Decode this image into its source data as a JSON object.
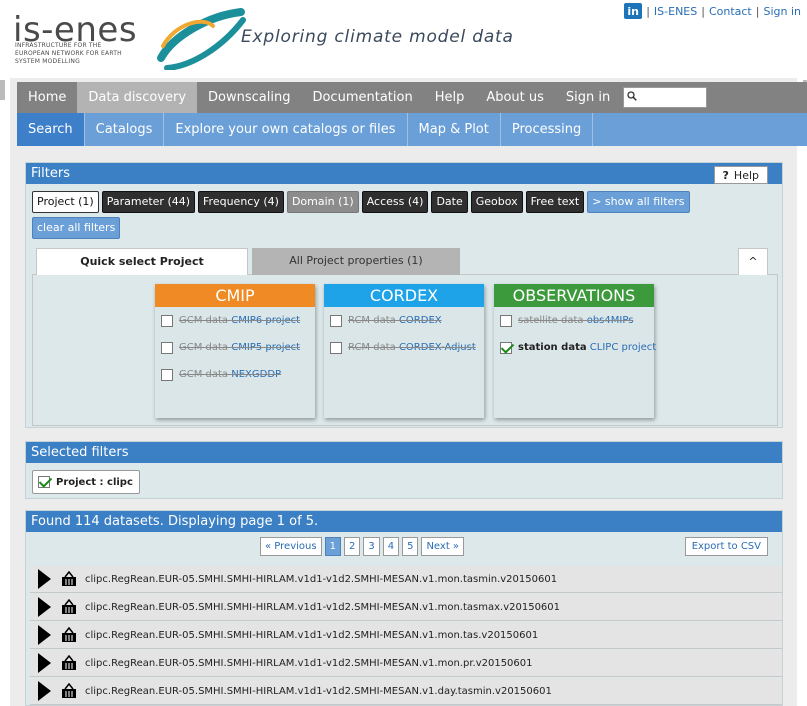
{
  "header": {
    "logo_text": "is-enes",
    "logo_subtitle": "INFRASTRUCTURE FOR THE EUROPEAN NETWORK FOR EARTH SYSTEM MODELLING",
    "tagline": "Exploring climate model data",
    "links": [
      "IS-ENES",
      "Contact",
      "Sign in"
    ],
    "linkedin": "in"
  },
  "nav_main": {
    "items": [
      "Home",
      "Data discovery",
      "Downscaling",
      "Documentation",
      "Help",
      "About us",
      "Sign in"
    ],
    "active": "Data discovery"
  },
  "nav_sub": {
    "items": [
      "Search",
      "Catalogs",
      "Explore your own catalogs or files",
      "Map & Plot",
      "Processing"
    ],
    "active": "Search"
  },
  "filters": {
    "title": "Filters",
    "help_label": "Help",
    "buttons": [
      "Project (1)",
      "Parameter (44)",
      "Frequency (4)",
      "Domain (1)",
      "Access (4)",
      "Date",
      "Geobox",
      "Free text",
      "> show all filters"
    ],
    "clear_label": "clear all filters",
    "tabs": [
      "Quick select Project",
      "All Project properties (1)",
      "^"
    ],
    "categories": [
      {
        "title": "CMIP",
        "color": "#f08a24",
        "rows": [
          {
            "text": "GCM data",
            "link": "CMIP6 project",
            "checked": false,
            "disabled": true
          },
          {
            "text": "GCM data",
            "link": "CMIP5 project",
            "checked": false,
            "disabled": true
          },
          {
            "text": "GCM data",
            "link": "NEXGDDP",
            "checked": false,
            "disabled": true
          }
        ]
      },
      {
        "title": "CORDEX",
        "color": "#1fa3e8",
        "rows": [
          {
            "text": "RCM data",
            "link": "CORDEX",
            "checked": false,
            "disabled": true
          },
          {
            "text": "RCM data",
            "link": "CORDEX-Adjust",
            "checked": false,
            "disabled": true
          }
        ]
      },
      {
        "title": "OBSERVATIONS",
        "color": "#3c9a3c",
        "rows": [
          {
            "text": "satellite data",
            "link": "obs4MIPs",
            "checked": false,
            "disabled": true
          },
          {
            "text": "station data",
            "link": "CLIPC project",
            "checked": true,
            "disabled": false
          }
        ]
      }
    ]
  },
  "selected_filters": {
    "title": "Selected filters",
    "chip": "Project : clipc"
  },
  "results": {
    "title": "Found 114 datasets. Displaying page 1 of 5.",
    "prev": "« Previous",
    "pages": [
      "1",
      "2",
      "3",
      "4",
      "5"
    ],
    "current_page": "1",
    "next": "Next »",
    "export": "Export to CSV",
    "datasets": [
      "clipc.RegRean.EUR-05.SMHI.SMHI-HIRLAM.v1d1-v1d2.SMHI-MESAN.v1.mon.tasmin.v20150601",
      "clipc.RegRean.EUR-05.SMHI.SMHI-HIRLAM.v1d1-v1d2.SMHI-MESAN.v1.mon.tasmax.v20150601",
      "clipc.RegRean.EUR-05.SMHI.SMHI-HIRLAM.v1d1-v1d2.SMHI-MESAN.v1.mon.tas.v20150601",
      "clipc.RegRean.EUR-05.SMHI.SMHI-HIRLAM.v1d1-v1d2.SMHI-MESAN.v1.mon.pr.v20150601",
      "clipc.RegRean.EUR-05.SMHI.SMHI-HIRLAM.v1d1-v1d2.SMHI-MESAN.v1.day.tasmin.v20150601"
    ]
  }
}
